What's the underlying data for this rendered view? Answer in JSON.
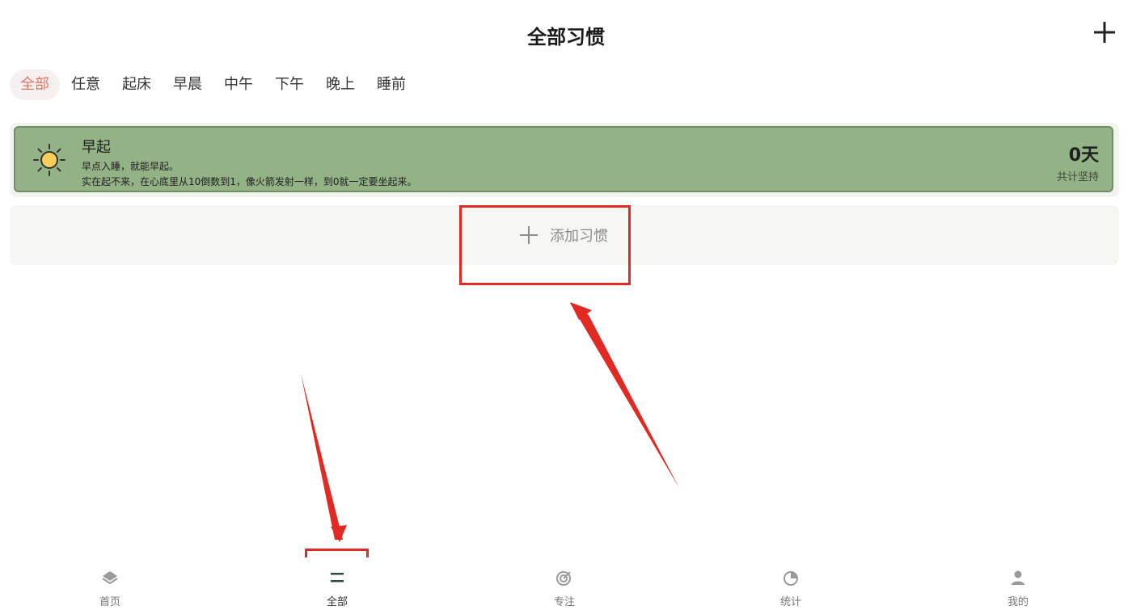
{
  "header": {
    "title": "全部习惯",
    "add_icon": "plus-icon"
  },
  "tabs": [
    {
      "label": "全部",
      "active": true
    },
    {
      "label": "任意",
      "active": false
    },
    {
      "label": "起床",
      "active": false
    },
    {
      "label": "早晨",
      "active": false
    },
    {
      "label": "中午",
      "active": false
    },
    {
      "label": "下午",
      "active": false
    },
    {
      "label": "晚上",
      "active": false
    },
    {
      "label": "睡前",
      "active": false
    }
  ],
  "habit": {
    "icon": "sun-icon",
    "name": "早起",
    "desc_line1": "早点入睡，就能早起。",
    "desc_line2": "实在起不来，在心底里从10倒数到1，像火箭发射一样，到0就一定要坐起来。",
    "days": "0天",
    "days_label": "共计坚持",
    "card_color": "#93b285"
  },
  "add_habit": {
    "label": "添加习惯",
    "icon": "plus-icon"
  },
  "nav": [
    {
      "label": "首页",
      "icon": "layers-icon"
    },
    {
      "label": "全部",
      "icon": "list-icon",
      "active": true
    },
    {
      "label": "专注",
      "icon": "target-icon"
    },
    {
      "label": "统计",
      "icon": "pie-chart-icon"
    },
    {
      "label": "我的",
      "icon": "user-icon"
    }
  ],
  "colors": {
    "accent": "#e4746b",
    "annotation": "#e02a23",
    "nav_active": "#2f4a45"
  }
}
